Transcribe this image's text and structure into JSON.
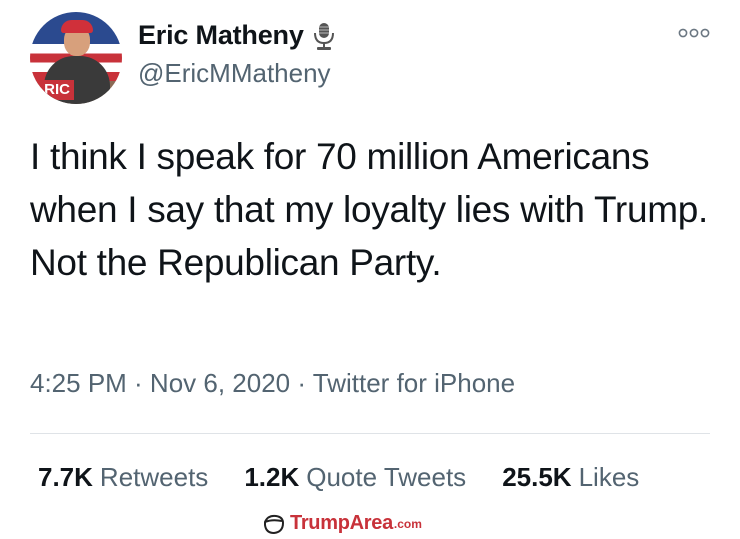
{
  "author": {
    "name": "Eric Matheny",
    "handle": "@EricMMatheny",
    "avatar_label": "RIC",
    "badge_icon": "microphone-icon"
  },
  "tweet": {
    "text": "I think I speak for 70 million Americans when I say that my loyalty lies with Trump. Not the Republican Party.",
    "meta": "4:25 PM · Nov 6, 2020 · Twitter for iPhone"
  },
  "stats": [
    {
      "value": "7.7K",
      "label": "Retweets"
    },
    {
      "value": "1.2K",
      "label": "Quote Tweets"
    },
    {
      "value": "25.5K",
      "label": "Likes"
    }
  ],
  "watermark": {
    "brand_trump": "Trump",
    "brand_area": "Area",
    "domain": ".com",
    "color": "#c8323a"
  },
  "colors": {
    "text": "#0f1419",
    "secondary": "#536471"
  }
}
